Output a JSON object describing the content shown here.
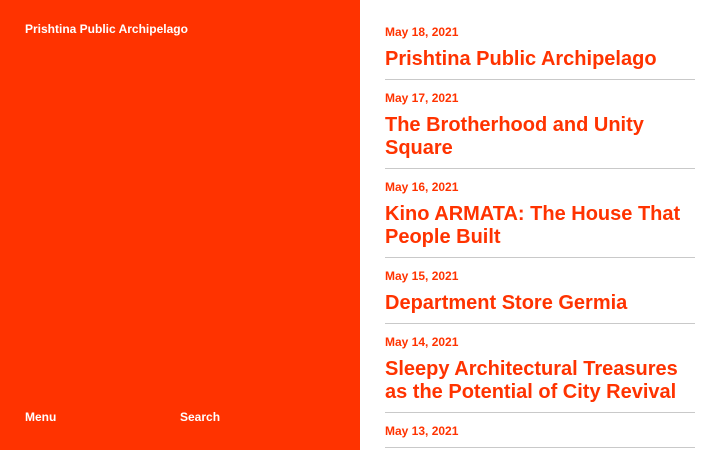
{
  "site": {
    "title": "Prishtina Public Archipelago"
  },
  "nav": {
    "menu_label": "Menu",
    "search_label": "Search"
  },
  "colors": {
    "accent": "#ff3300",
    "background": "#ffffff",
    "divider": "#c9c9c9"
  },
  "posts": [
    {
      "date": "May 18, 2021",
      "title": "Prishtina Public Archipelago"
    },
    {
      "date": "May 17, 2021",
      "title": "The Brotherhood and Unity Square"
    },
    {
      "date": "May 16, 2021",
      "title": "Kino ARMATA: The House That People Built"
    },
    {
      "date": "May 15, 2021",
      "title": "Department Store Germia"
    },
    {
      "date": "May 14, 2021",
      "title": "Sleepy Architectural Treasures as the Potential of City Revival"
    },
    {
      "date": "May 13, 2021",
      "title": ""
    }
  ]
}
